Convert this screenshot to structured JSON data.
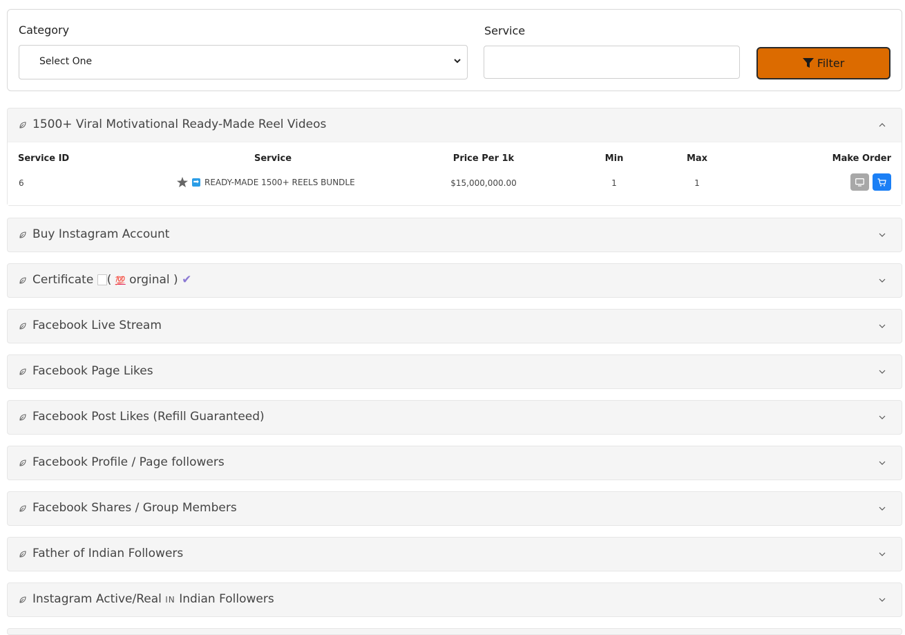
{
  "filter": {
    "category_label": "Category",
    "category_value": "Select One",
    "service_label": "Service",
    "service_value": "",
    "filter_button": "Filter",
    "accent_color": "#dc6b00"
  },
  "open_category": {
    "title": "1500+ Viral Motivational Ready-Made Reel Videos",
    "columns": [
      "Service ID",
      "Service",
      "Price Per 1k",
      "Min",
      "Max",
      "Make Order"
    ],
    "row": {
      "id": "6",
      "service": "READY-MADE 1500+ REELS BUNDLE",
      "price": "$15,000,000.00",
      "min": "1",
      "max": "1"
    }
  },
  "categories": [
    {
      "title": "Buy Instagram Account"
    },
    {
      "title_pre": "Certificate",
      "title_mid": "orginal )",
      "paren_open": "(",
      "hundred": "💯",
      "check": "✔"
    },
    {
      "title": "Facebook Live Stream"
    },
    {
      "title": "Facebook Page Likes"
    },
    {
      "title": "Facebook Post Likes (Refill Guaranteed)"
    },
    {
      "title": "Facebook Profile / Page followers"
    },
    {
      "title": "Facebook Shares / Group Members"
    },
    {
      "title": "Father of Indian Followers"
    },
    {
      "title_pre": "Instagram Active/Real",
      "flag": "IN",
      "title_post": "Indian Followers"
    }
  ]
}
